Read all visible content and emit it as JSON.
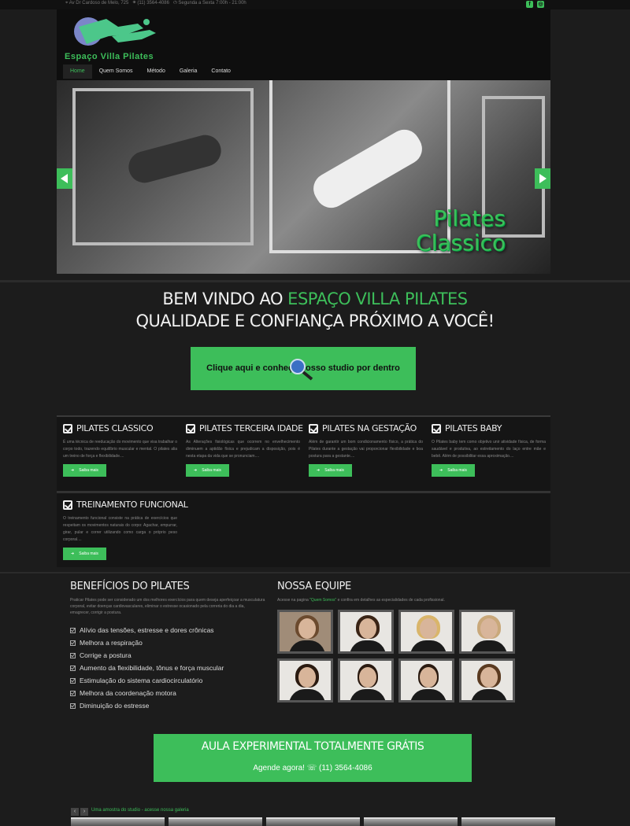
{
  "topbar": {
    "address": "Av Dr Cardoso de Melo, 725",
    "phone": "(11) 3564-4086",
    "hours": "Segunda a Sexta 7:00h - 21:00h",
    "social": [
      "facebook-icon",
      "instagram-icon"
    ]
  },
  "logo": {
    "text": "Espaço Villa Pilates"
  },
  "nav": [
    "Home",
    "Quem Somos",
    "Método",
    "Galeria",
    "Contato"
  ],
  "slider": {
    "caption_line1": "Pilates",
    "caption_line2": "Classico"
  },
  "welcome": {
    "line1_prefix": "BEM VINDO AO ",
    "line1_highlight": "ESPAÇO VILLA PILATES",
    "line2": "QUALIDADE E CONFIANÇA PRÓXIMO A VOCÊ!"
  },
  "cta_studio": "Clique aqui e conheça nosso studio por dentro",
  "services": [
    {
      "title": "PILATES CLASSICO",
      "text": "É uma técnica de reeducação do movimento que visa trabalhar o corpo todo, trazendo equilíbrio muscular e mental. O pilates alia um treino de força e flexibilidade....",
      "button": "Saiba mais"
    },
    {
      "title": "PILATES TERCEIRA IDADE",
      "text": "As Alterações fisiológicas que ocorrem no envelhecimento diminuem a aptidão física e prejudicam a disposição, pois é nesta etapa da vida que se pronunciam....",
      "button": "Saiba mais"
    },
    {
      "title": "PILATES NA GESTAÇÃO",
      "text": "Além de garantir um bom condicionamento físico, a prática do Pilates durante a gestação vai proporcionar flexibilidade e boa postura para a gestante....",
      "button": "Saiba mais"
    },
    {
      "title": "PILATES BABY",
      "text": "O Pilates baby tem como objetivo unir atividade física, de forma saudável e produtiva, ao estreitamento do laço entre mãe e bebê. Além de possibilitar essa aproximação....",
      "button": "Saiba mais"
    },
    {
      "title": "TREINAMENTO FUNCIONAL",
      "text": "O treinamento funcional consiste na prática de exercícios que respeitam os movimentos naturais do corpo: Agachar, empurrar, girar, pular e correr utilizando como carga o próprio peso corporal....",
      "button": "Saiba mais"
    }
  ],
  "benefits": {
    "title": "BENEFÍCIOS DO PILATES",
    "intro": "Praticar Pilates pode ser considerado um dos melhores exercícios para quem deseja aperfeiçoar a musculatura corporal, evitar doenças cardiovasculares, eliminar o estresse ocasionado pela correria do dia a dia, emagrecer, corrigir a postura.",
    "items": [
      "Alívio das tensões, estresse e dores crônicas",
      "Melhora a respiração",
      "Corrige a postura",
      "Aumento da flexibilidade, tônus e força muscular",
      "Estimulação do sistema cardiocirculatório",
      "Melhora da coordenação motora",
      "Diminuição do estresse"
    ]
  },
  "team": {
    "title": "NOSSA EQUIPE",
    "intro_prefix": "Acesse na pagina ",
    "intro_link": "\"Quem Somos\"",
    "intro_suffix": " e confira em detalhes as especialidades de cada profissional."
  },
  "free_class": {
    "title": "AULA EXPERIMENTAL TOTALMENTE GRÁTIS",
    "subtitle": "Agende agora!",
    "phone": "(11) 3564-4086"
  },
  "gallery": {
    "label": "Uma amostra do studio - acesse nossa galeria",
    "prev": "‹",
    "next": "›"
  },
  "colors": {
    "accent": "#3dbe5a",
    "background": "#1c1c1c"
  }
}
